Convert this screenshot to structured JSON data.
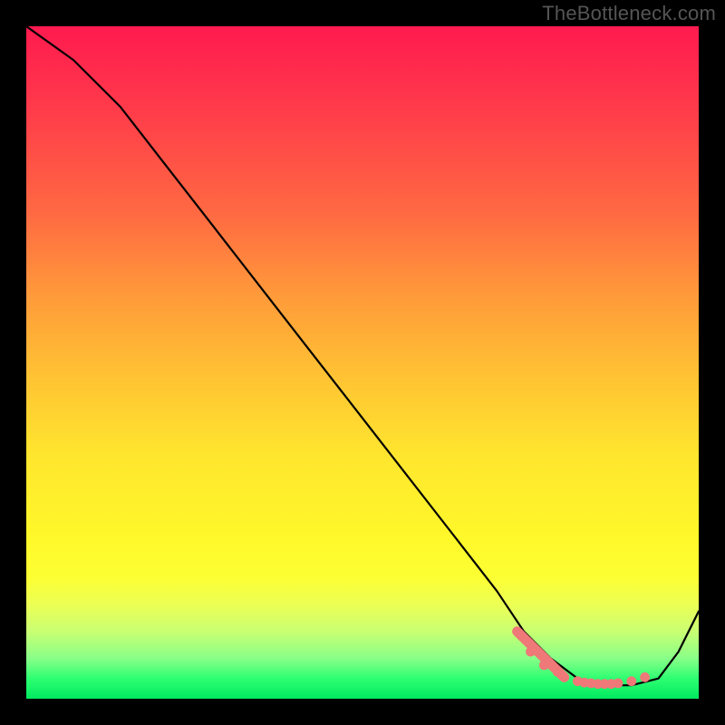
{
  "attribution": "TheBottleneck.com",
  "chart_data": {
    "type": "line",
    "title": "",
    "xlabel": "",
    "ylabel": "",
    "xlim": [
      0,
      100
    ],
    "ylim": [
      0,
      100
    ],
    "grid": false,
    "legend": false,
    "series": [
      {
        "name": "curve",
        "x": [
          0,
          7,
          14,
          21,
          28,
          35,
          42,
          49,
          56,
          63,
          70,
          74,
          78,
          82,
          86,
          90,
          94,
          97,
          100
        ],
        "y": [
          100,
          95,
          88,
          79,
          70,
          61,
          52,
          43,
          34,
          25,
          16,
          10,
          6,
          3,
          2,
          2,
          3,
          7,
          13
        ]
      }
    ],
    "markers": {
      "name": "highlight-dots",
      "color": "#ef7878",
      "x": [
        73,
        75,
        77,
        79,
        80,
        82,
        83,
        84,
        85,
        86,
        87,
        88,
        90,
        92
      ],
      "y": [
        10,
        7,
        5,
        4,
        3.2,
        2.6,
        2.4,
        2.3,
        2.2,
        2.2,
        2.2,
        2.3,
        2.6,
        3.2
      ]
    },
    "colors": {
      "curve": "#000000",
      "background_gradient_top": "#ff1a4f",
      "background_gradient_bottom": "#00e85f",
      "markers": "#ef7878",
      "frame": "#000000"
    }
  }
}
